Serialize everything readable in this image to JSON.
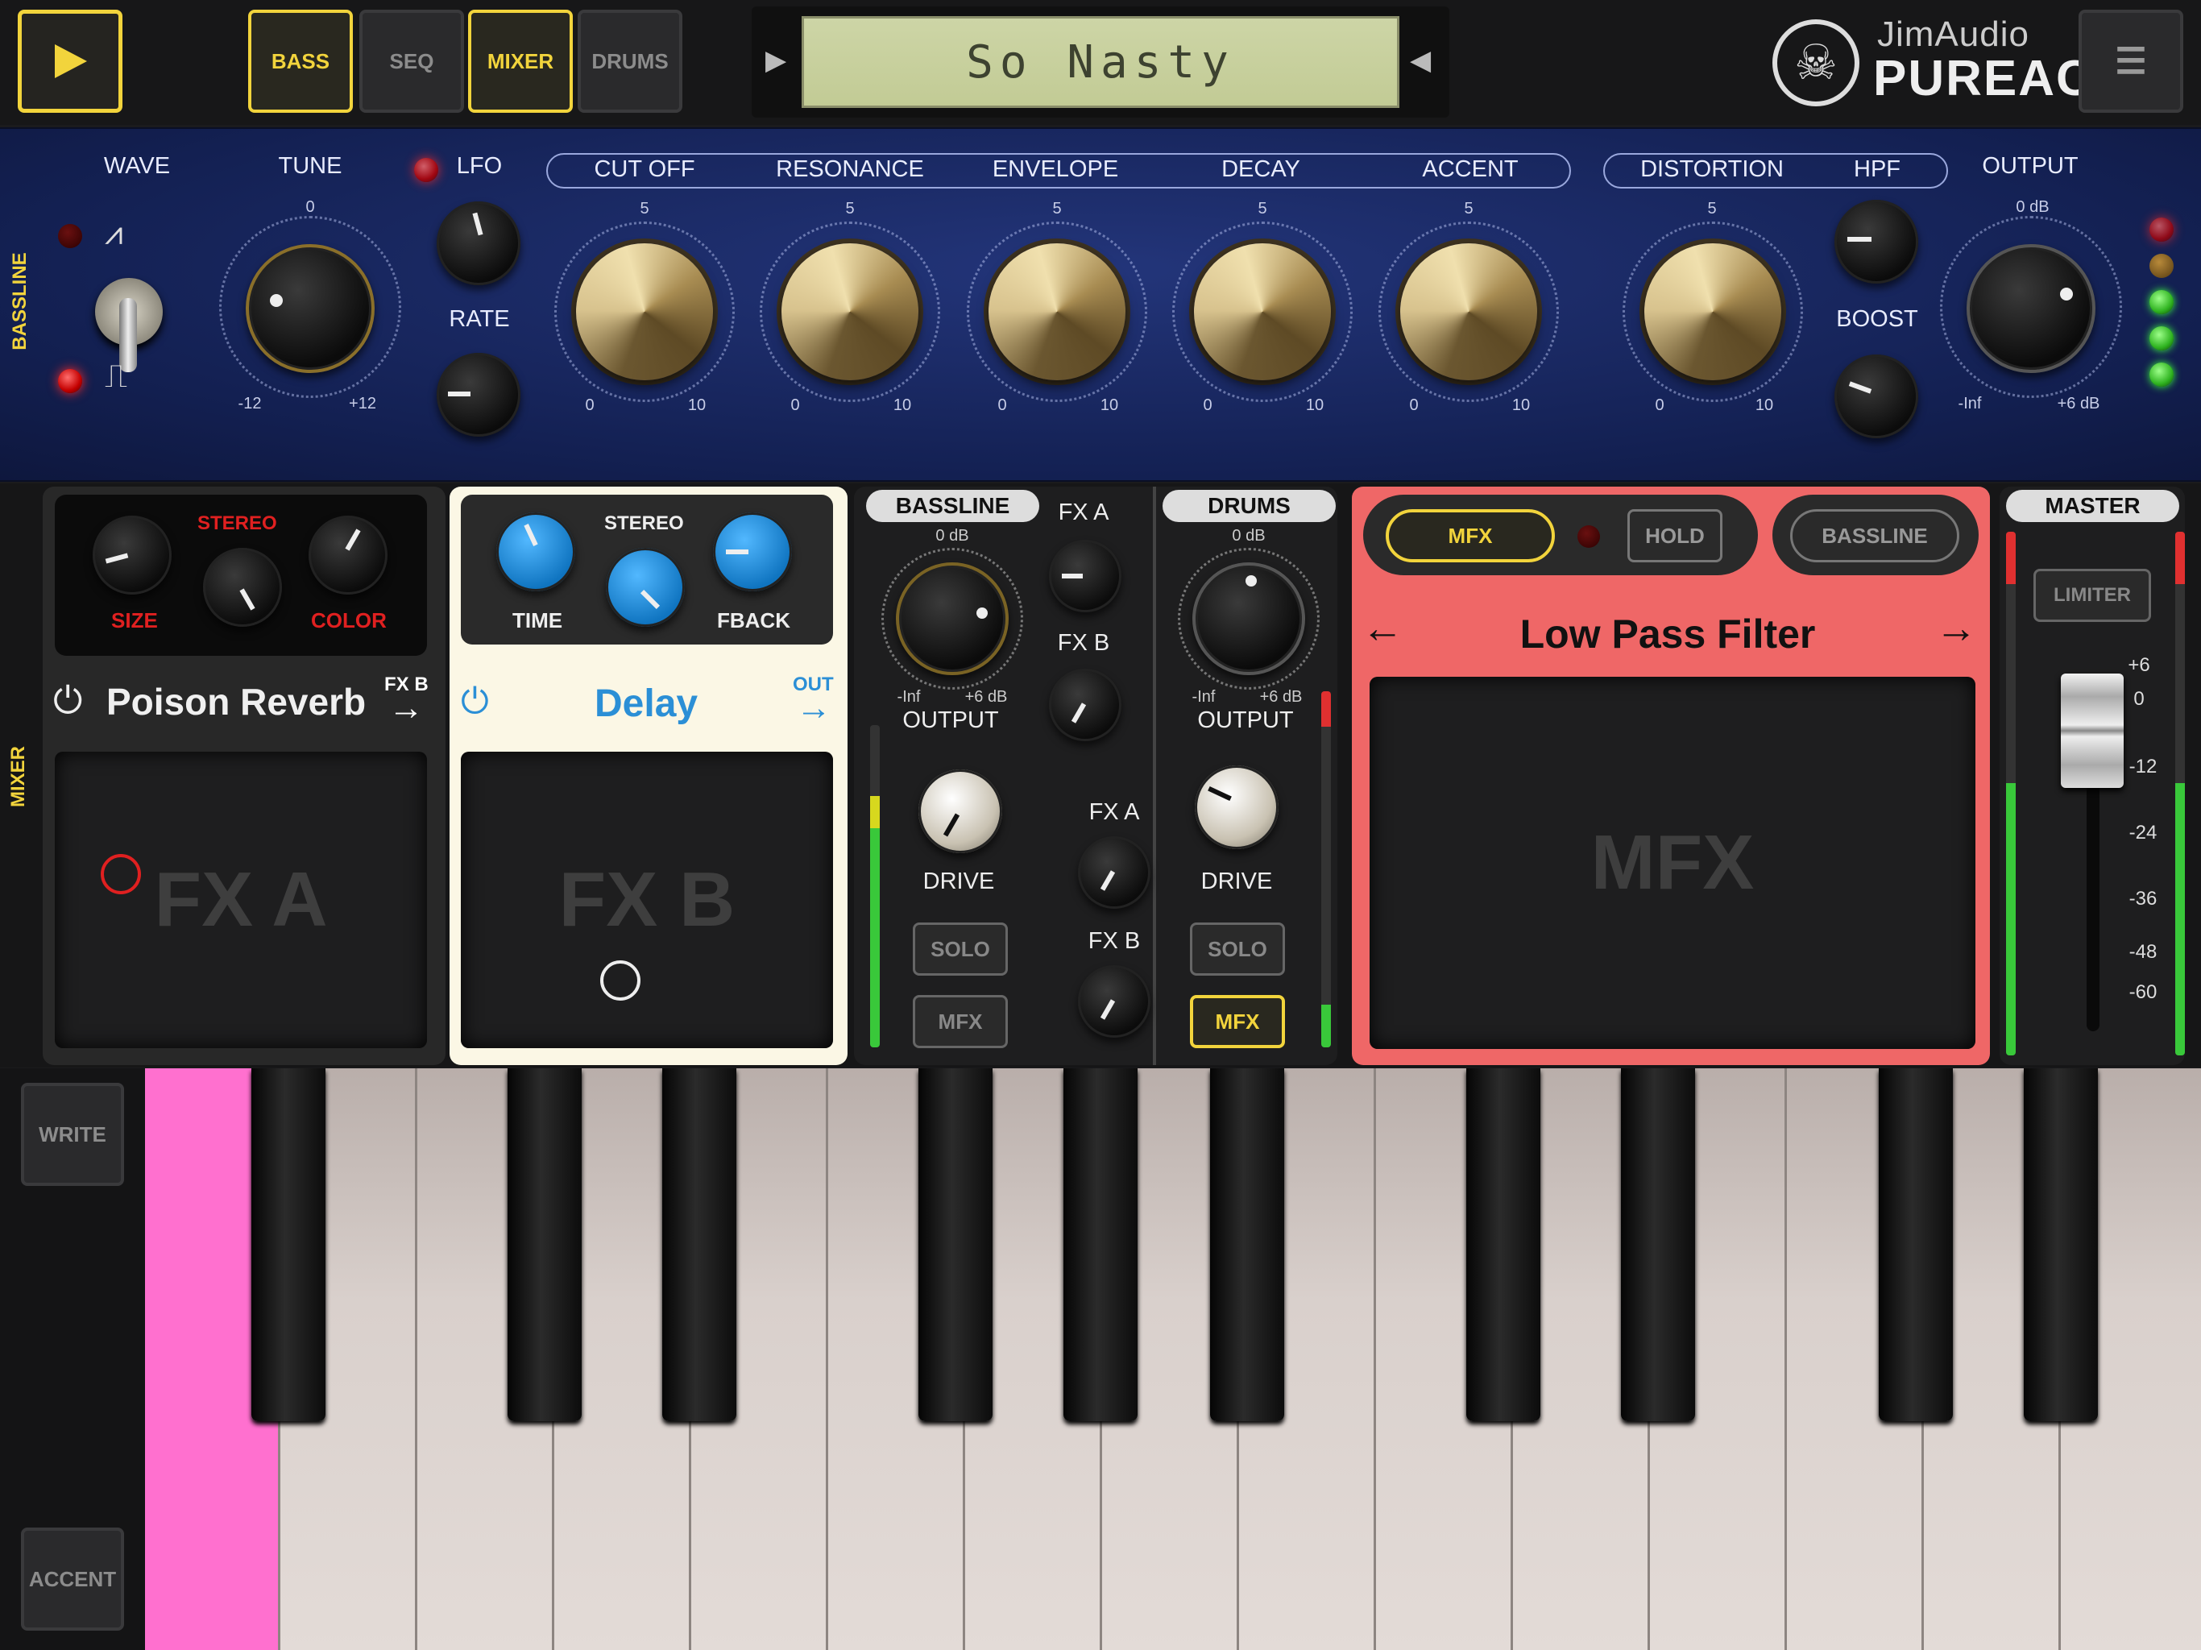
{
  "topbar": {
    "tabs": [
      {
        "label": "BASS",
        "active": true
      },
      {
        "label": "SEQ",
        "active": false
      },
      {
        "label": "MIXER",
        "active": true
      },
      {
        "label": "DRUMS",
        "active": false
      }
    ],
    "preset_name": "So Nasty",
    "brand_top": "JimAudio",
    "brand_bottom": "PUREACID"
  },
  "bassline": {
    "side_label": "BASSLINE",
    "wave_label": "WAVE",
    "tune_label": "TUNE",
    "tune_center": "0",
    "tune_min": "-12",
    "tune_max": "+12",
    "lfo_label": "LFO",
    "rate_label": "RATE",
    "filter_labels": [
      "CUT OFF",
      "RESONANCE",
      "ENVELOPE",
      "DECAY",
      "ACCENT"
    ],
    "mid": "5",
    "min": "0",
    "max": "10",
    "distortion_label": "DISTORTION",
    "hpf_label": "HPF",
    "boost_label": "BOOST",
    "output_label": "OUTPUT",
    "out_db": "0 dB",
    "out_min": "-Inf",
    "out_max": "+6 dB"
  },
  "mixer": {
    "side_label": "MIXER",
    "fxa": {
      "stereo": "STEREO",
      "size": "SIZE",
      "color": "COLOR",
      "name": "Poison Reverb",
      "route": "FX B",
      "pad": "FX A"
    },
    "fxb": {
      "time": "TIME",
      "stereo": "STEREO",
      "fback": "FBACK",
      "name": "Delay",
      "route": "OUT",
      "pad": "FX B"
    },
    "bass": {
      "title": "BASSLINE",
      "db": "0 dB",
      "min": "-Inf",
      "max": "+6 dB",
      "output": "OUTPUT",
      "drive": "DRIVE",
      "solo": "SOLO",
      "mfx": "MFX",
      "fxa": "FX A",
      "fxb": "FX B"
    },
    "drums": {
      "title": "DRUMS",
      "db": "0 dB",
      "min": "-Inf",
      "max": "+6 dB",
      "output": "OUTPUT",
      "drive": "DRIVE",
      "solo": "SOLO",
      "mfx": "MFX",
      "fxa": "FX A",
      "fxb": "FX B"
    },
    "mfx": {
      "mfx_btn": "MFX",
      "hold": "HOLD",
      "bassline": "BASSLINE",
      "filter": "Low Pass Filter",
      "pad": "MFX"
    },
    "master": {
      "title": "MASTER",
      "limiter": "LIMITER",
      "scale": [
        "+6",
        "0",
        "-12",
        "-24",
        "-36",
        "-48",
        "-60"
      ],
      "fader_db": 0
    }
  },
  "keyboard": {
    "write": "WRITE",
    "accent": "ACCENT"
  },
  "colors": {
    "yellow": "#f2d43c",
    "mfx_panel": "#f06a6a",
    "delay_blue": "#2b8fd6",
    "pressed_key": "#ff70cf"
  }
}
